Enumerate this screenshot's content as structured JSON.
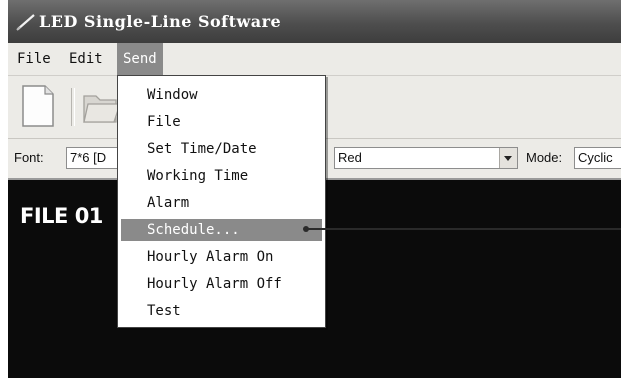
{
  "window": {
    "title": "LED Single-Line Software"
  },
  "menubar": {
    "items": [
      {
        "label": "File"
      },
      {
        "label": "Edit"
      },
      {
        "label": "Send",
        "active": true
      }
    ]
  },
  "toolbar": {
    "buttons": [
      {
        "icon": "new-document-icon"
      },
      {
        "icon": "open-folder-icon"
      }
    ]
  },
  "fontbar": {
    "font_label": "Font:",
    "font_value": "7*6 [D",
    "color_value": "Red",
    "mode_label": "Mode:",
    "mode_value": "Cyclic"
  },
  "display": {
    "text": "FILE 01"
  },
  "send_menu": {
    "items": [
      {
        "label": "Window"
      },
      {
        "label": "File"
      },
      {
        "label": "Set Time/Date"
      },
      {
        "label": "Working Time"
      },
      {
        "label": "Alarm"
      },
      {
        "label": "Schedule...",
        "highlighted": true
      },
      {
        "label": "Hourly Alarm On"
      },
      {
        "label": "Hourly Alarm Off"
      },
      {
        "label": "Test"
      }
    ]
  },
  "colors": {
    "titlebar": "#4e4e4e",
    "highlight": "#8a8a8a",
    "display_background": "#0b0b0b",
    "chrome": "#ecebe7"
  }
}
